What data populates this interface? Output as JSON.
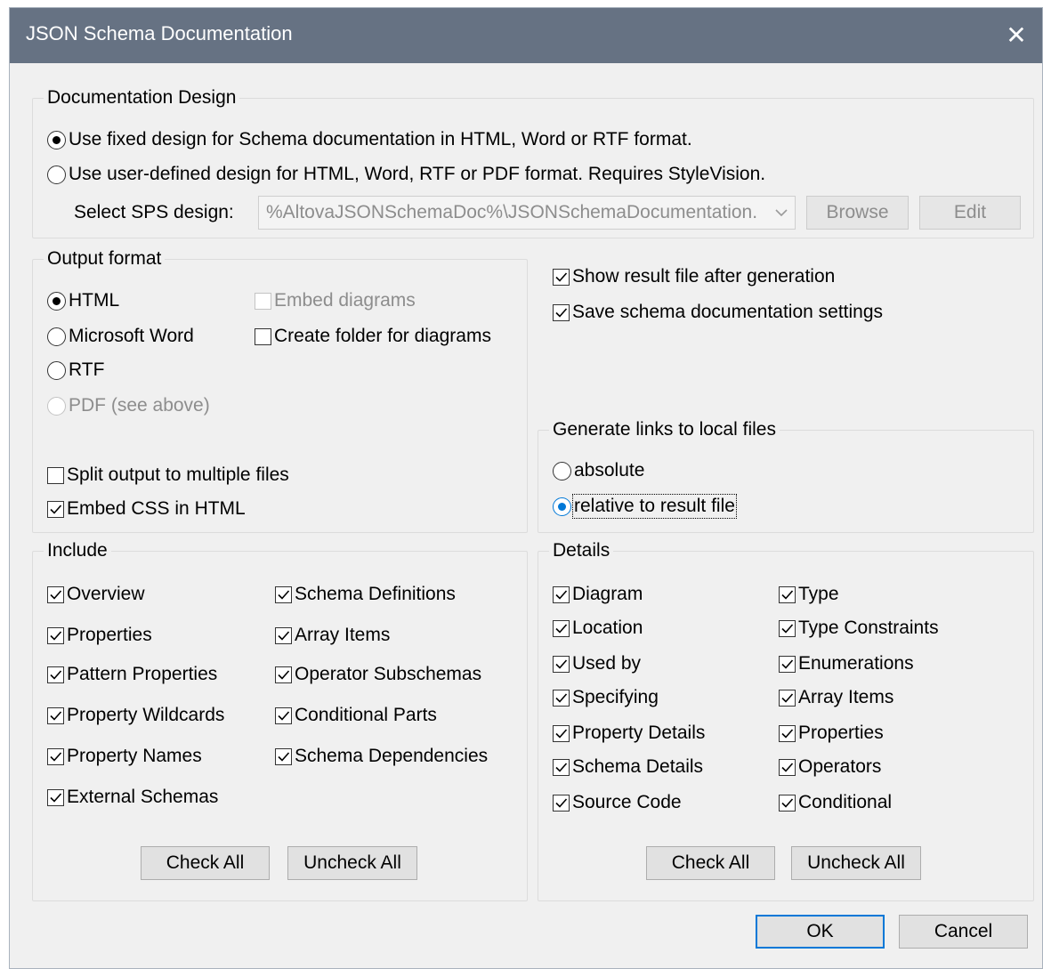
{
  "window": {
    "title": "JSON Schema Documentation",
    "close_glyph": "✕"
  },
  "documentation_design": {
    "legend": "Documentation Design",
    "fixed_label": "Use fixed design for Schema documentation in HTML, Word or RTF format.",
    "user_label": "Use user-defined design for HTML, Word, RTF or PDF format. Requires StyleVision.",
    "sps_label": "Select SPS design:",
    "sps_value": "%AltovaJSONSchemaDoc%\\JSONSchemaDocumentation.",
    "browse_label": "Browse",
    "edit_label": "Edit"
  },
  "output_format": {
    "legend": "Output format",
    "html": "HTML",
    "word": "Microsoft Word",
    "rtf": "RTF",
    "pdf": "PDF (see above)",
    "embed_diagrams": "Embed diagrams",
    "create_folder": "Create folder for diagrams",
    "split_output": "Split output to multiple files",
    "embed_css": "Embed CSS in HTML"
  },
  "options": {
    "show_result": "Show result file after generation",
    "save_settings": "Save schema documentation settings"
  },
  "links": {
    "legend": "Generate links to local files",
    "absolute": "absolute",
    "relative": "relative to result file"
  },
  "include": {
    "legend": "Include",
    "left": [
      "Overview",
      "Properties",
      "Pattern Properties",
      "Property Wildcards",
      "Property Names",
      "External Schemas"
    ],
    "right": [
      "Schema Definitions",
      "Array Items",
      "Operator Subschemas",
      "Conditional Parts",
      "Schema Dependencies"
    ],
    "check_all": "Check All",
    "uncheck_all": "Uncheck All"
  },
  "details": {
    "legend": "Details",
    "left": [
      "Diagram",
      "Location",
      "Used by",
      "Specifying",
      "Property Details",
      "Schema Details",
      "Source Code"
    ],
    "right": [
      "Type",
      "Type Constraints",
      "Enumerations",
      "Array Items",
      "Properties",
      "Operators",
      "Conditional"
    ],
    "check_all": "Check All",
    "uncheck_all": "Uncheck All"
  },
  "footer": {
    "ok": "OK",
    "cancel": "Cancel"
  },
  "colors": {
    "titlebar": "#667283",
    "accent": "#0078d7",
    "dialog_bg": "#f0f0f0"
  }
}
